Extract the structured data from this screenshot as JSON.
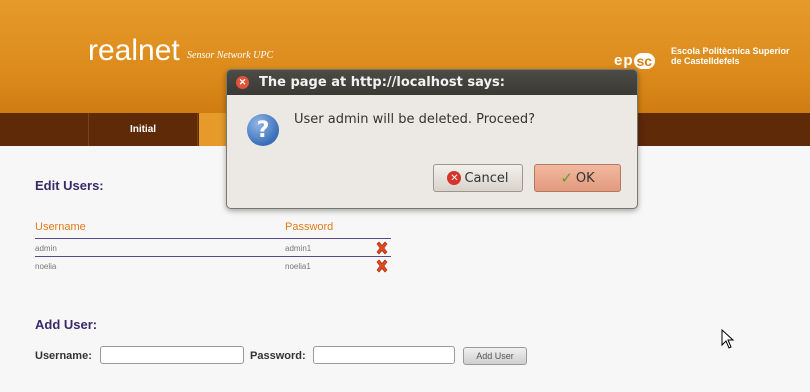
{
  "header": {
    "brand": "realnet",
    "brand_sub": "Sensor Network UPC",
    "logo_text_e": "e",
    "logo_text_p": "p",
    "logo_text_sc": "sc",
    "school_line1": "Escola Politècnica Superior",
    "school_line2": "de Castelldefels"
  },
  "nav": {
    "items": [
      {
        "label": "Initial"
      }
    ]
  },
  "edit_users": {
    "title": "Edit Users:",
    "columns": [
      "Username",
      "Password"
    ],
    "rows": [
      {
        "username": "admin",
        "password": "admin1"
      },
      {
        "username": "noelia",
        "password": "noelia1"
      }
    ]
  },
  "add_user": {
    "title": "Add User:",
    "username_label": "Username:",
    "password_label": "Password:",
    "button": "Add User"
  },
  "dialog": {
    "title": "The page at http://localhost says:",
    "message": "User admin will be deleted. Proceed?",
    "cancel": "Cancel",
    "ok": "OK"
  },
  "colors": {
    "header": "#e59a2a",
    "nav": "#5e2a08",
    "heading": "#3b2a6a",
    "column_head": "#e07b1a"
  },
  "icons": [
    "close-icon",
    "question-icon",
    "delete-icon",
    "cancel-icon",
    "check-icon",
    "mouse-cursor-icon"
  ]
}
